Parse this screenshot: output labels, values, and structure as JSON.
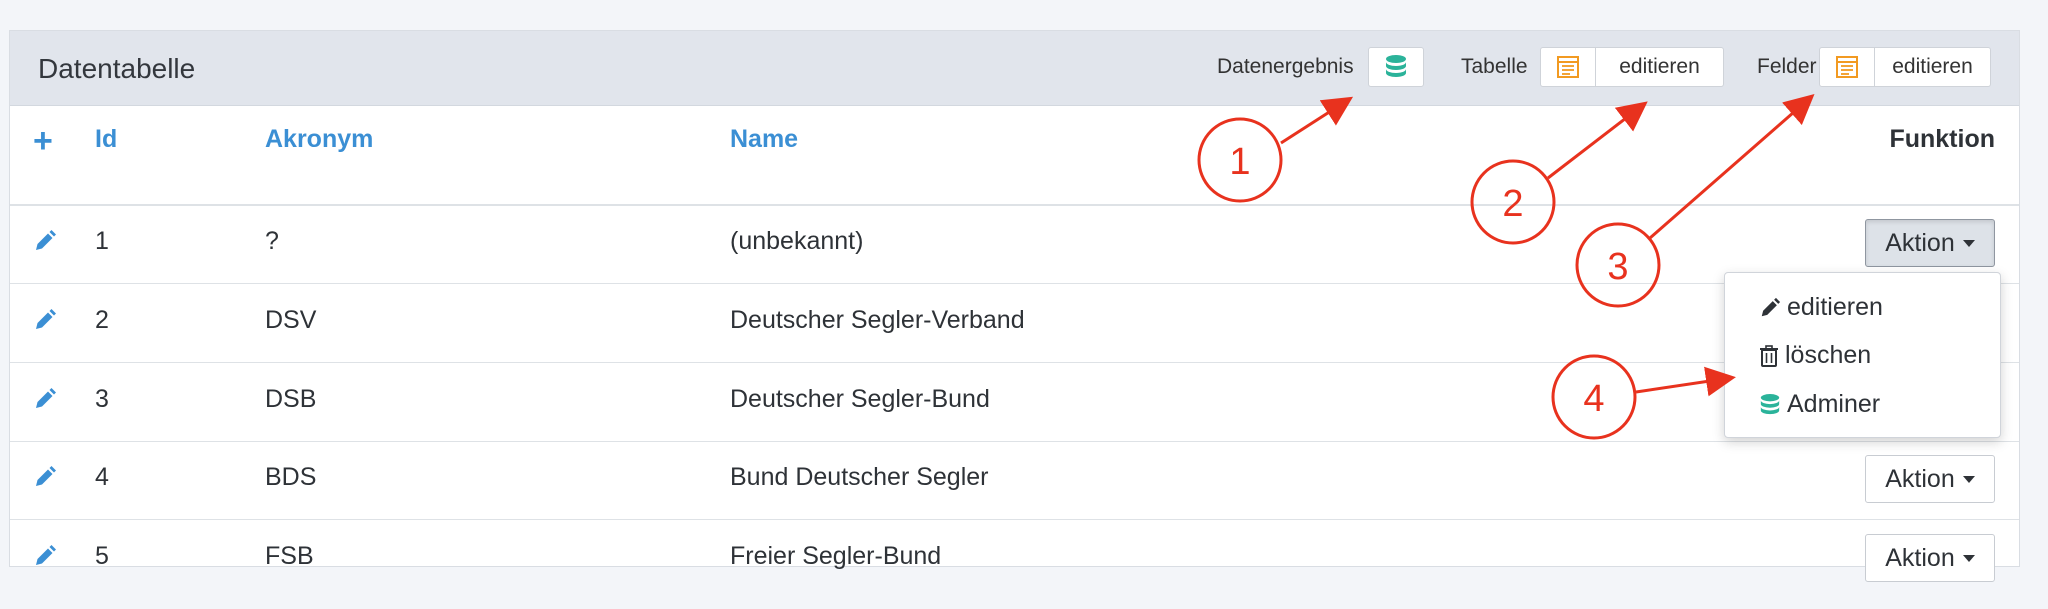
{
  "panel": {
    "title": "Datentabelle",
    "header_buttons": {
      "datenergebnis_label": "Datenergebnis",
      "tabelle_label": "Tabelle",
      "tabelle_edit": "editieren",
      "felder_label": "Felder",
      "felder_edit": "editieren"
    }
  },
  "table": {
    "columns": [
      "Id",
      "Akronym",
      "Name",
      "Funktion"
    ],
    "rows": [
      {
        "id": "1",
        "akronym": "?",
        "name": "(unbekannt)"
      },
      {
        "id": "2",
        "akronym": "DSV",
        "name": "Deutscher Segler-Verband"
      },
      {
        "id": "3",
        "akronym": "DSB",
        "name": "Deutscher Segler-Bund"
      },
      {
        "id": "4",
        "akronym": "BDS",
        "name": "Bund Deutscher Segler"
      },
      {
        "id": "5",
        "akronym": "FSB",
        "name": "Freier Segler-Bund"
      }
    ],
    "action_label": "Aktion"
  },
  "dropdown": {
    "items": [
      "editieren",
      "löschen",
      "Adminer"
    ]
  },
  "annotations": {
    "labels": [
      "1",
      "2",
      "3",
      "4"
    ],
    "color": "#e8321e"
  },
  "colors": {
    "link_blue": "#3b8fd4",
    "db_teal": "#2bb39a",
    "table_orange": "#f29a21"
  }
}
